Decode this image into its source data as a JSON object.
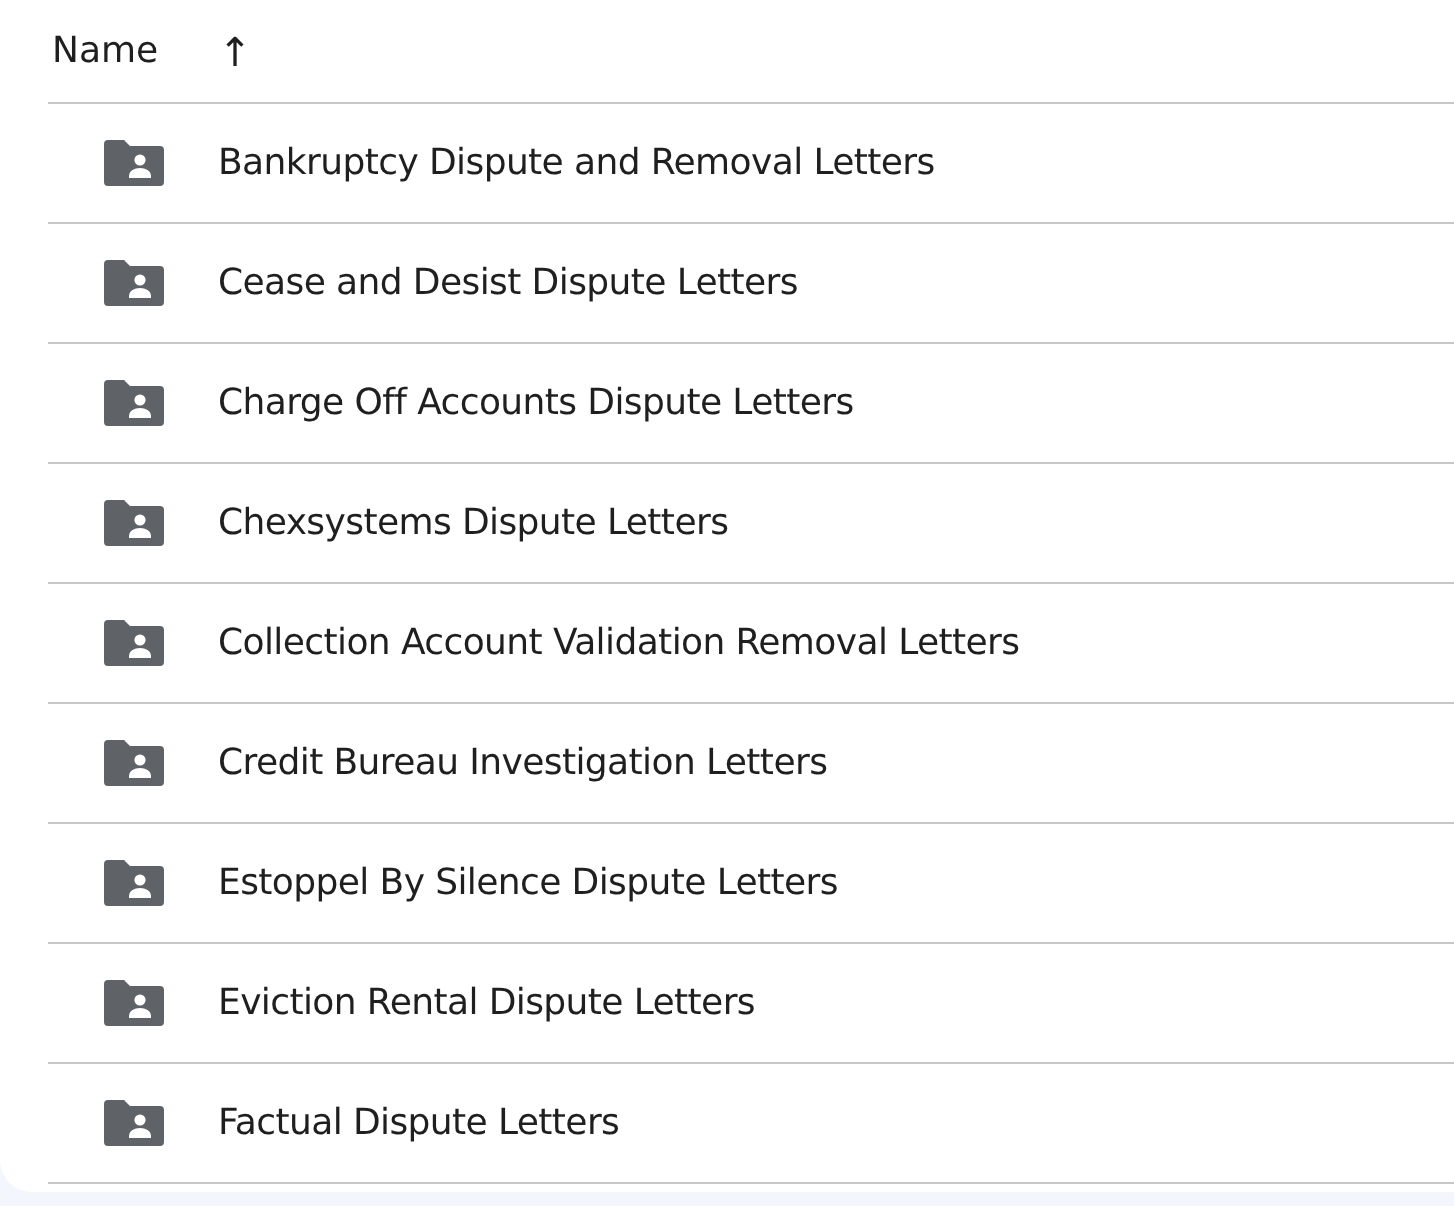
{
  "header": {
    "column": "Name",
    "sort_icon": "↑"
  },
  "folders": [
    {
      "name": "Bankruptcy Dispute and Removal Letters"
    },
    {
      "name": "Cease and Desist Dispute Letters"
    },
    {
      "name": "Charge Off Accounts Dispute Letters"
    },
    {
      "name": "Chexsystems Dispute Letters"
    },
    {
      "name": "Collection Account Validation Removal Letters"
    },
    {
      "name": "Credit Bureau Investigation Letters"
    },
    {
      "name": "Estoppel By Silence Dispute Letters"
    },
    {
      "name": "Eviction Rental Dispute Letters"
    },
    {
      "name": "Factual Dispute Letters"
    }
  ]
}
